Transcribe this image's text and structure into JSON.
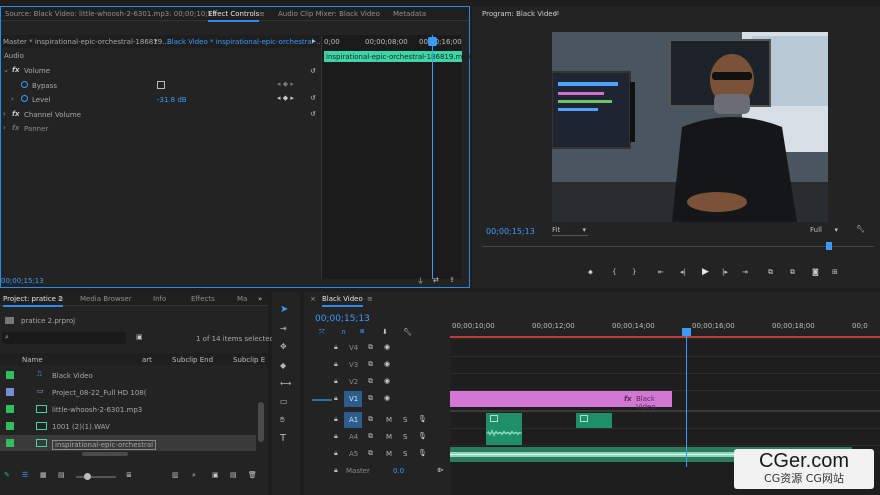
{
  "colors": {
    "accent": "#2d8ceb",
    "clip_video": "#d277d3",
    "clip_audio": "#1f8f6a",
    "clip_label_ec": "#3fd4a5",
    "playhead": "#3a9bff"
  },
  "source_panel": {
    "tabs": [
      "Source: Black Video: little-whoosh-2-6301.mp3: 00;00;10;13",
      "Effect Controls",
      "Audio Clip Mixer: Black Video",
      "Metadata"
    ],
    "master_label": "Master * inspirational-epic-orchestral-186819....",
    "sequence_label": "Black Video * inspirational-epic-orchestral-...",
    "ruler": [
      "0;00",
      "00;00;08;00",
      "00;00;16;00"
    ],
    "clip_label": "inspirational-epic-orchestral-186819.mp3",
    "section": "Audio",
    "volume": {
      "label": "Volume",
      "bypass_label": "Bypass",
      "level_label": "Level",
      "level_value": "-31.8 dB"
    },
    "channel_volume": "Channel Volume",
    "panner": "Panner",
    "timecode": "00;00;15;13"
  },
  "program": {
    "title": "Program: Black Video",
    "timecode": "00;00;15;13",
    "fit": "Fit",
    "quality": "Full",
    "controls": [
      "marker-icon",
      "mark-in-icon",
      "mark-out-icon",
      "go-to-in-icon",
      "step-back-icon",
      "play-icon",
      "step-forward-icon",
      "go-to-out-icon",
      "lift-icon",
      "extract-icon",
      "camera-icon",
      "compare-icon"
    ]
  },
  "project": {
    "tabs": [
      "Project: pratice 2",
      "Media Browser",
      "Info",
      "Effects",
      "Ma"
    ],
    "file": "pratice 2.prproj",
    "items_count": "1 of 14 items selected",
    "columns": [
      "Name",
      "art",
      "Subclip End",
      "Subclip E"
    ],
    "items": [
      {
        "name": "Black Video",
        "color": "#2fbf5b"
      },
      {
        "name": "Project_08-22_Full HD 108(",
        "color": "#7a8ed6"
      },
      {
        "name": "little-whoosh-2-6301.mp3",
        "color": "#2fbf5b"
      },
      {
        "name": "1001 (2)(1).WAV",
        "color": "#2fbf5b"
      },
      {
        "name": "inspirational-epic-orchestral",
        "color": "#2fbf5b"
      }
    ]
  },
  "timeline": {
    "tab": "Black Video",
    "timecode": "00;00;15;13",
    "ruler": [
      "00;00;10;00",
      "00;00;12;00",
      "00;00;14;00",
      "00;00;16;00",
      "00;00;18;00",
      "00;0"
    ],
    "video_tracks": [
      "V4",
      "V3",
      "V2",
      "V1"
    ],
    "audio_tracks": [
      "A1",
      "A4",
      "A5"
    ],
    "track_buttons": [
      "M",
      "S"
    ],
    "master_label": "Master",
    "master_value": "0.0",
    "video_clip": "Black Video",
    "fx_label": "fx"
  },
  "watermark": {
    "title": "CGer.com",
    "subtitle": "CG资源 CG网站"
  }
}
